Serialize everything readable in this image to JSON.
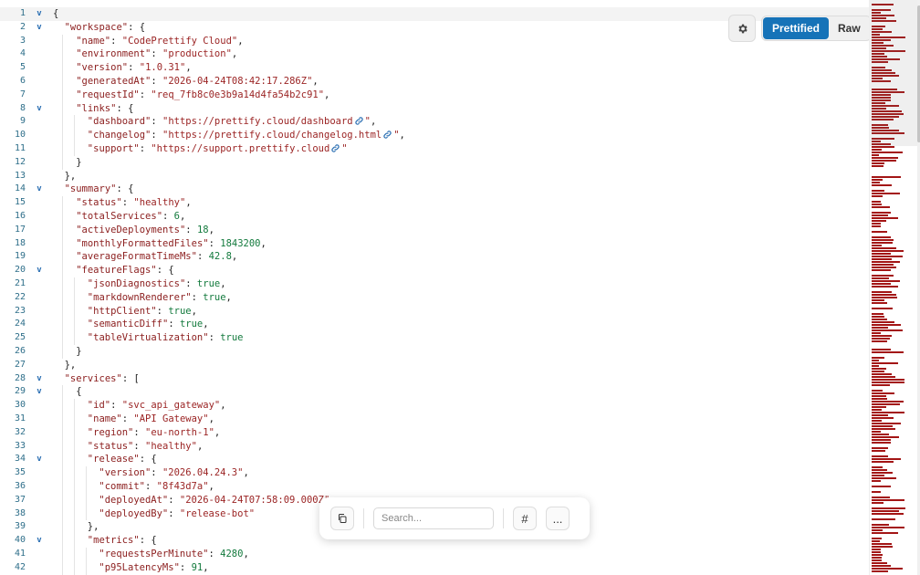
{
  "toolbar": {
    "settings_icon": "gear-icon",
    "view_modes": [
      {
        "label": "Prettified",
        "active": true
      },
      {
        "label": "Raw",
        "active": false
      }
    ]
  },
  "floating_bar": {
    "copy_icon": "copy-icon",
    "search_placeholder": "Search...",
    "line_numbers_label": "#",
    "more_label": "..."
  },
  "colors": {
    "key": "#8b1d1d",
    "string": "#9b2424",
    "number": "#137a3d",
    "accent": "#1673b8"
  },
  "lines": [
    {
      "n": "1",
      "fold": true,
      "indent": 0,
      "tokens": [
        [
          "p",
          "{"
        ]
      ]
    },
    {
      "n": "2",
      "fold": true,
      "indent": 1,
      "tokens": [
        [
          "k",
          "\"workspace\""
        ],
        [
          "p",
          ": {"
        ]
      ]
    },
    {
      "n": "3",
      "fold": false,
      "indent": 2,
      "tokens": [
        [
          "k",
          "\"name\""
        ],
        [
          "p",
          ": "
        ],
        [
          "s",
          "\"CodePrettify Cloud\""
        ],
        [
          "p",
          ","
        ]
      ]
    },
    {
      "n": "4",
      "fold": false,
      "indent": 2,
      "tokens": [
        [
          "k",
          "\"environment\""
        ],
        [
          "p",
          ": "
        ],
        [
          "s",
          "\"production\""
        ],
        [
          "p",
          ","
        ]
      ]
    },
    {
      "n": "5",
      "fold": false,
      "indent": 2,
      "tokens": [
        [
          "k",
          "\"version\""
        ],
        [
          "p",
          ": "
        ],
        [
          "s",
          "\"1.0.31\""
        ],
        [
          "p",
          ","
        ]
      ]
    },
    {
      "n": "6",
      "fold": false,
      "indent": 2,
      "tokens": [
        [
          "k",
          "\"generatedAt\""
        ],
        [
          "p",
          ": "
        ],
        [
          "s",
          "\"2026-04-24T08:42:17.286Z\""
        ],
        [
          "p",
          ","
        ]
      ]
    },
    {
      "n": "7",
      "fold": false,
      "indent": 2,
      "tokens": [
        [
          "k",
          "\"requestId\""
        ],
        [
          "p",
          ": "
        ],
        [
          "s",
          "\"req_7fb8c0e3b9a14d4fa54b2c91\""
        ],
        [
          "p",
          ","
        ]
      ]
    },
    {
      "n": "8",
      "fold": true,
      "indent": 2,
      "tokens": [
        [
          "k",
          "\"links\""
        ],
        [
          "p",
          ": {"
        ]
      ]
    },
    {
      "n": "9",
      "fold": false,
      "indent": 3,
      "tokens": [
        [
          "k",
          "\"dashboard\""
        ],
        [
          "p",
          ": "
        ],
        [
          "s",
          "\"https://prettify.cloud/dashboard"
        ],
        [
          "link",
          ""
        ],
        [
          "s",
          "\""
        ],
        [
          "p",
          ","
        ]
      ]
    },
    {
      "n": "10",
      "fold": false,
      "indent": 3,
      "tokens": [
        [
          "k",
          "\"changelog\""
        ],
        [
          "p",
          ": "
        ],
        [
          "s",
          "\"https://prettify.cloud/changelog.html"
        ],
        [
          "link",
          ""
        ],
        [
          "s",
          "\""
        ],
        [
          "p",
          ","
        ]
      ]
    },
    {
      "n": "11",
      "fold": false,
      "indent": 3,
      "tokens": [
        [
          "k",
          "\"support\""
        ],
        [
          "p",
          ": "
        ],
        [
          "s",
          "\"https://support.prettify.cloud"
        ],
        [
          "link",
          ""
        ],
        [
          "s",
          "\""
        ]
      ]
    },
    {
      "n": "12",
      "fold": false,
      "indent": 2,
      "tokens": [
        [
          "p",
          "}"
        ]
      ]
    },
    {
      "n": "13",
      "fold": false,
      "indent": 1,
      "tokens": [
        [
          "p",
          "},"
        ]
      ]
    },
    {
      "n": "14",
      "fold": true,
      "indent": 1,
      "tokens": [
        [
          "k",
          "\"summary\""
        ],
        [
          "p",
          ": {"
        ]
      ]
    },
    {
      "n": "15",
      "fold": false,
      "indent": 2,
      "tokens": [
        [
          "k",
          "\"status\""
        ],
        [
          "p",
          ": "
        ],
        [
          "s",
          "\"healthy\""
        ],
        [
          "p",
          ","
        ]
      ]
    },
    {
      "n": "16",
      "fold": false,
      "indent": 2,
      "tokens": [
        [
          "k",
          "\"totalServices\""
        ],
        [
          "p",
          ": "
        ],
        [
          "n",
          "6"
        ],
        [
          "p",
          ","
        ]
      ]
    },
    {
      "n": "17",
      "fold": false,
      "indent": 2,
      "tokens": [
        [
          "k",
          "\"activeDeployments\""
        ],
        [
          "p",
          ": "
        ],
        [
          "n",
          "18"
        ],
        [
          "p",
          ","
        ]
      ]
    },
    {
      "n": "18",
      "fold": false,
      "indent": 2,
      "tokens": [
        [
          "k",
          "\"monthlyFormattedFiles\""
        ],
        [
          "p",
          ": "
        ],
        [
          "n",
          "1843200"
        ],
        [
          "p",
          ","
        ]
      ]
    },
    {
      "n": "19",
      "fold": false,
      "indent": 2,
      "tokens": [
        [
          "k",
          "\"averageFormatTimeMs\""
        ],
        [
          "p",
          ": "
        ],
        [
          "n",
          "42.8"
        ],
        [
          "p",
          ","
        ]
      ]
    },
    {
      "n": "20",
      "fold": true,
      "indent": 2,
      "tokens": [
        [
          "k",
          "\"featureFlags\""
        ],
        [
          "p",
          ": {"
        ]
      ]
    },
    {
      "n": "21",
      "fold": false,
      "indent": 3,
      "tokens": [
        [
          "k",
          "\"jsonDiagnostics\""
        ],
        [
          "p",
          ": "
        ],
        [
          "b",
          "true"
        ],
        [
          "p",
          ","
        ]
      ]
    },
    {
      "n": "22",
      "fold": false,
      "indent": 3,
      "tokens": [
        [
          "k",
          "\"markdownRenderer\""
        ],
        [
          "p",
          ": "
        ],
        [
          "b",
          "true"
        ],
        [
          "p",
          ","
        ]
      ]
    },
    {
      "n": "23",
      "fold": false,
      "indent": 3,
      "tokens": [
        [
          "k",
          "\"httpClient\""
        ],
        [
          "p",
          ": "
        ],
        [
          "b",
          "true"
        ],
        [
          "p",
          ","
        ]
      ]
    },
    {
      "n": "24",
      "fold": false,
      "indent": 3,
      "tokens": [
        [
          "k",
          "\"semanticDiff\""
        ],
        [
          "p",
          ": "
        ],
        [
          "b",
          "true"
        ],
        [
          "p",
          ","
        ]
      ]
    },
    {
      "n": "25",
      "fold": false,
      "indent": 3,
      "tokens": [
        [
          "k",
          "\"tableVirtualization\""
        ],
        [
          "p",
          ": "
        ],
        [
          "b",
          "true"
        ]
      ]
    },
    {
      "n": "26",
      "fold": false,
      "indent": 2,
      "tokens": [
        [
          "p",
          "}"
        ]
      ]
    },
    {
      "n": "27",
      "fold": false,
      "indent": 1,
      "tokens": [
        [
          "p",
          "},"
        ]
      ]
    },
    {
      "n": "28",
      "fold": true,
      "indent": 1,
      "tokens": [
        [
          "k",
          "\"services\""
        ],
        [
          "p",
          ": ["
        ]
      ]
    },
    {
      "n": "29",
      "fold": true,
      "indent": 2,
      "tokens": [
        [
          "p",
          "{"
        ]
      ]
    },
    {
      "n": "30",
      "fold": false,
      "indent": 3,
      "tokens": [
        [
          "k",
          "\"id\""
        ],
        [
          "p",
          ": "
        ],
        [
          "s",
          "\"svc_api_gateway\""
        ],
        [
          "p",
          ","
        ]
      ]
    },
    {
      "n": "31",
      "fold": false,
      "indent": 3,
      "tokens": [
        [
          "k",
          "\"name\""
        ],
        [
          "p",
          ": "
        ],
        [
          "s",
          "\"API Gateway\""
        ],
        [
          "p",
          ","
        ]
      ]
    },
    {
      "n": "32",
      "fold": false,
      "indent": 3,
      "tokens": [
        [
          "k",
          "\"region\""
        ],
        [
          "p",
          ": "
        ],
        [
          "s",
          "\"eu-north-1\""
        ],
        [
          "p",
          ","
        ]
      ]
    },
    {
      "n": "33",
      "fold": false,
      "indent": 3,
      "tokens": [
        [
          "k",
          "\"status\""
        ],
        [
          "p",
          ": "
        ],
        [
          "s",
          "\"healthy\""
        ],
        [
          "p",
          ","
        ]
      ]
    },
    {
      "n": "34",
      "fold": true,
      "indent": 3,
      "tokens": [
        [
          "k",
          "\"release\""
        ],
        [
          "p",
          ": {"
        ]
      ]
    },
    {
      "n": "35",
      "fold": false,
      "indent": 4,
      "tokens": [
        [
          "k",
          "\"version\""
        ],
        [
          "p",
          ": "
        ],
        [
          "s",
          "\"2026.04.24.3\""
        ],
        [
          "p",
          ","
        ]
      ]
    },
    {
      "n": "36",
      "fold": false,
      "indent": 4,
      "tokens": [
        [
          "k",
          "\"commit\""
        ],
        [
          "p",
          ": "
        ],
        [
          "s",
          "\"8f43d7a\""
        ],
        [
          "p",
          ","
        ]
      ]
    },
    {
      "n": "37",
      "fold": false,
      "indent": 4,
      "tokens": [
        [
          "k",
          "\"deployedAt\""
        ],
        [
          "p",
          ": "
        ],
        [
          "s",
          "\"2026-04-24T07:58:09.000Z\""
        ],
        [
          "p",
          ","
        ]
      ]
    },
    {
      "n": "38",
      "fold": false,
      "indent": 4,
      "tokens": [
        [
          "k",
          "\"deployedBy\""
        ],
        [
          "p",
          ": "
        ],
        [
          "s",
          "\"release-bot\""
        ]
      ]
    },
    {
      "n": "39",
      "fold": false,
      "indent": 3,
      "tokens": [
        [
          "p",
          "},"
        ]
      ]
    },
    {
      "n": "40",
      "fold": true,
      "indent": 3,
      "tokens": [
        [
          "k",
          "\"metrics\""
        ],
        [
          "p",
          ": {"
        ]
      ]
    },
    {
      "n": "41",
      "fold": false,
      "indent": 4,
      "tokens": [
        [
          "k",
          "\"requestsPerMinute\""
        ],
        [
          "p",
          ": "
        ],
        [
          "n",
          "4280"
        ],
        [
          "p",
          ","
        ]
      ]
    },
    {
      "n": "42",
      "fold": false,
      "indent": 4,
      "tokens": [
        [
          "k",
          "\"p95LatencyMs\""
        ],
        [
          "p",
          ": "
        ],
        [
          "n",
          "91"
        ],
        [
          "p",
          ","
        ]
      ]
    }
  ]
}
